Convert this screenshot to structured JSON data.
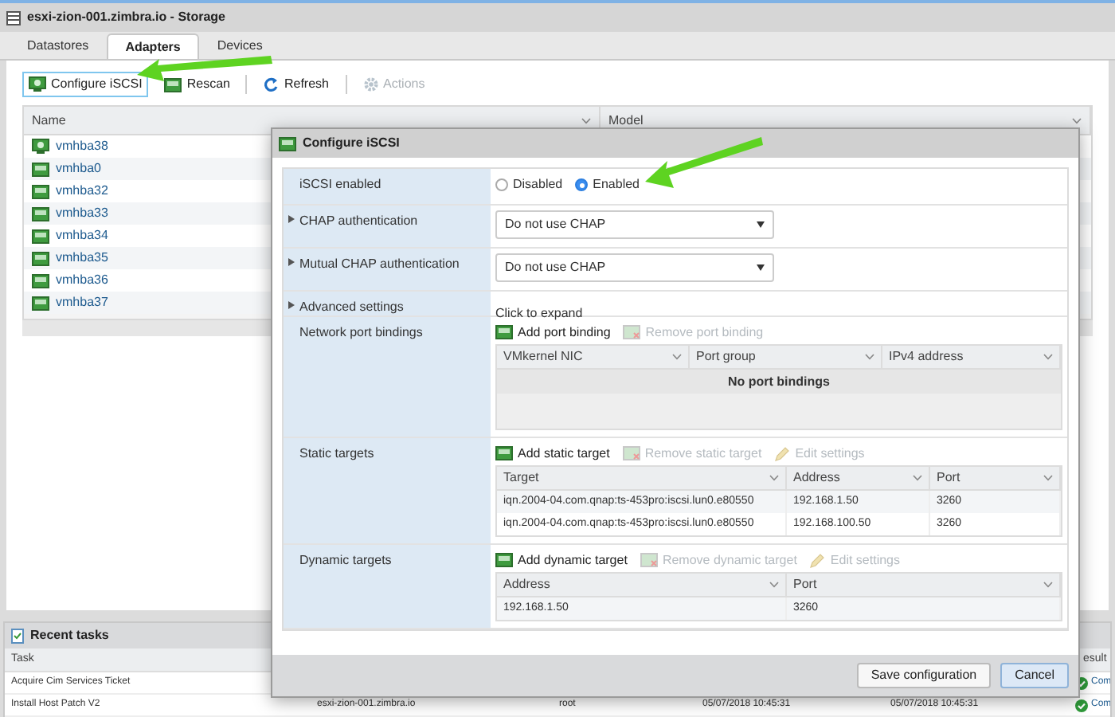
{
  "window": {
    "title": "esxi-zion-001.zimbra.io - Storage"
  },
  "tabs": [
    {
      "label": "Datastores",
      "selected": false
    },
    {
      "label": "Adapters",
      "selected": true
    },
    {
      "label": "Devices",
      "selected": false
    }
  ],
  "toolbar": [
    {
      "label": "Configure iSCSI",
      "kind": "configure",
      "focused": true,
      "disabled": false
    },
    {
      "label": "Rescan",
      "kind": "rescan",
      "focused": false,
      "disabled": false
    },
    {
      "label": "Refresh",
      "kind": "refresh",
      "focused": false,
      "disabled": false
    },
    {
      "label": "Actions",
      "kind": "actions",
      "focused": false,
      "disabled": true
    }
  ],
  "adapters": {
    "columns": [
      "Name",
      "Model"
    ],
    "rows": [
      {
        "name": "vmhba38",
        "kind": "iscsi"
      },
      {
        "name": "vmhba0",
        "kind": "hba"
      },
      {
        "name": "vmhba32",
        "kind": "hba"
      },
      {
        "name": "vmhba33",
        "kind": "hba"
      },
      {
        "name": "vmhba34",
        "kind": "hba"
      },
      {
        "name": "vmhba35",
        "kind": "hba"
      },
      {
        "name": "vmhba36",
        "kind": "hba"
      },
      {
        "name": "vmhba37",
        "kind": "hba"
      }
    ]
  },
  "recent_tasks": {
    "title": "Recent tasks",
    "columns": [
      "Task",
      "esult"
    ],
    "rows": [
      {
        "task": "Acquire Cim Services Ticket",
        "result": "Com"
      },
      {
        "task": "Install Host Patch V2",
        "column_2": "esxi-zion-001.zimbra.io",
        "column_3": "root",
        "column_4": "05/07/2018 10:45:31",
        "column_5": "05/07/2018 10:45:31",
        "result": "Com"
      }
    ]
  },
  "dialog": {
    "title": "Configure iSCSI",
    "settings": [
      {
        "kind": "radio",
        "label": "iSCSI enabled",
        "expandable": false,
        "options": [
          {
            "label": "Disabled",
            "selected": false
          },
          {
            "label": "Enabled",
            "selected": true
          }
        ]
      },
      {
        "kind": "select",
        "label": "CHAP authentication",
        "expandable": true,
        "value": "Do not use CHAP"
      },
      {
        "kind": "select",
        "label": "Mutual CHAP authentication",
        "expandable": true,
        "value": "Do not use CHAP"
      },
      {
        "kind": "link",
        "label": "Advanced settings",
        "expandable": true,
        "value": "Click to expand"
      },
      {
        "kind": "table",
        "label": "Network port bindings",
        "expandable": false,
        "actions": [
          {
            "label": "Add port binding",
            "kind": "add",
            "disabled": false
          },
          {
            "label": "Remove port binding",
            "kind": "remove",
            "disabled": true
          }
        ],
        "columns": [
          "VMkernel NIC",
          "Port group",
          "IPv4 address"
        ],
        "empty": "No port bindings"
      },
      {
        "kind": "table",
        "label": "Static targets",
        "expandable": false,
        "actions": [
          {
            "label": "Add static target",
            "kind": "add",
            "disabled": false
          },
          {
            "label": "Remove static target",
            "kind": "remove",
            "disabled": true
          },
          {
            "label": "Edit settings",
            "kind": "edit",
            "disabled": true
          }
        ],
        "columns": [
          "Target",
          "Address",
          "Port"
        ],
        "rows": [
          [
            "iqn.2004-04.com.qnap:ts-453pro:iscsi.lun0.e80550",
            "192.168.1.50",
            "3260"
          ],
          [
            "iqn.2004-04.com.qnap:ts-453pro:iscsi.lun0.e80550",
            "192.168.100.50",
            "3260"
          ]
        ]
      },
      {
        "kind": "table",
        "label": "Dynamic targets",
        "expandable": false,
        "actions": [
          {
            "label": "Add dynamic target",
            "kind": "add",
            "disabled": false
          },
          {
            "label": "Remove dynamic target",
            "kind": "remove",
            "disabled": true
          },
          {
            "label": "Edit settings",
            "kind": "edit",
            "disabled": true
          }
        ],
        "columns": [
          "Address",
          "Port"
        ],
        "rows": [
          [
            "192.168.1.50",
            "3260"
          ]
        ]
      }
    ],
    "buttons": [
      {
        "label": "Save configuration",
        "primary": false
      },
      {
        "label": "Cancel",
        "primary": true
      }
    ]
  }
}
